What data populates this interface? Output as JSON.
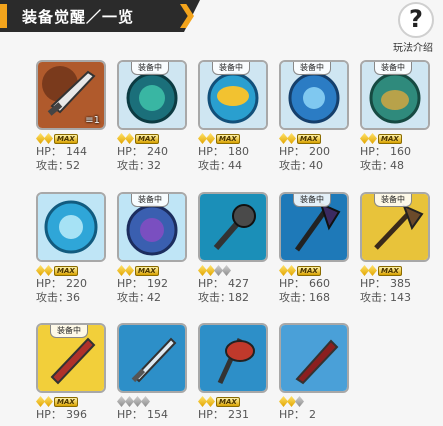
{
  "header": {
    "title": "装备觉醒／一览",
    "help_symbol": "?",
    "help_label": "玩法介绍"
  },
  "labels": {
    "hp": "HP：",
    "atk": "攻击：",
    "max": "MAX",
    "equipped": "装备中"
  },
  "colors": {
    "accent": "#f3a41c",
    "header_bg": "#2b2b2b",
    "gold": "#f0c020"
  },
  "items": [
    {
      "icon": "sword-portrait-icon",
      "equipped": false,
      "count": "≡1",
      "stars": [
        "gold",
        "gold"
      ],
      "max": true,
      "hp": "144",
      "atk": "52"
    },
    {
      "icon": "teal-shield-icon",
      "equipped": true,
      "count": "",
      "stars": [
        "gold",
        "gold"
      ],
      "max": true,
      "hp": "240",
      "atk": "32"
    },
    {
      "icon": "gold-shield-icon",
      "equipped": true,
      "count": "",
      "stars": [
        "gold",
        "gold"
      ],
      "max": true,
      "hp": "180",
      "atk": "44"
    },
    {
      "icon": "blue-shield-icon",
      "equipped": true,
      "count": "",
      "stars": [
        "gold",
        "gold"
      ],
      "max": true,
      "hp": "200",
      "atk": "40"
    },
    {
      "icon": "green-shield-icon",
      "equipped": true,
      "count": "",
      "stars": [
        "gold",
        "gold"
      ],
      "max": true,
      "hp": "160",
      "atk": "48"
    },
    {
      "icon": "aqua-shield-icon",
      "equipped": false,
      "count": "",
      "stars": [
        "gold",
        "gold"
      ],
      "max": true,
      "hp": "220",
      "atk": "36"
    },
    {
      "icon": "purple-shield-icon",
      "equipped": true,
      "count": "",
      "stars": [
        "gold",
        "gold"
      ],
      "max": true,
      "hp": "192",
      "atk": "42"
    },
    {
      "icon": "mace-icon",
      "equipped": false,
      "count": "",
      "stars": [
        "gold",
        "gold",
        "gray",
        "gray"
      ],
      "max": false,
      "hp": "427",
      "atk": "182"
    },
    {
      "icon": "dark-axe-icon",
      "equipped": true,
      "count": "",
      "stars": [
        "gold",
        "gold"
      ],
      "max": true,
      "hp": "660",
      "atk": "168"
    },
    {
      "icon": "brown-axe-icon",
      "equipped": true,
      "count": "",
      "stars": [
        "gold",
        "gold"
      ],
      "max": true,
      "hp": "385",
      "atk": "143"
    },
    {
      "icon": "red-blade-icon",
      "equipped": true,
      "count": "",
      "stars": [
        "gold",
        "gold"
      ],
      "max": true,
      "hp": "396",
      "atk": ""
    },
    {
      "icon": "ice-sword-icon",
      "equipped": false,
      "count": "",
      "stars": [
        "gray",
        "gray",
        "gray",
        "gray"
      ],
      "max": false,
      "hp": "154",
      "atk": ""
    },
    {
      "icon": "red-axe-icon",
      "equipped": false,
      "count": "",
      "stars": [
        "gold",
        "gold"
      ],
      "max": true,
      "hp": "231",
      "atk": ""
    },
    {
      "icon": "crimson-sword-icon",
      "equipped": false,
      "count": "",
      "stars": [
        "gold",
        "gold",
        "gray"
      ],
      "max": false,
      "hp": "2",
      "atk": ""
    }
  ]
}
